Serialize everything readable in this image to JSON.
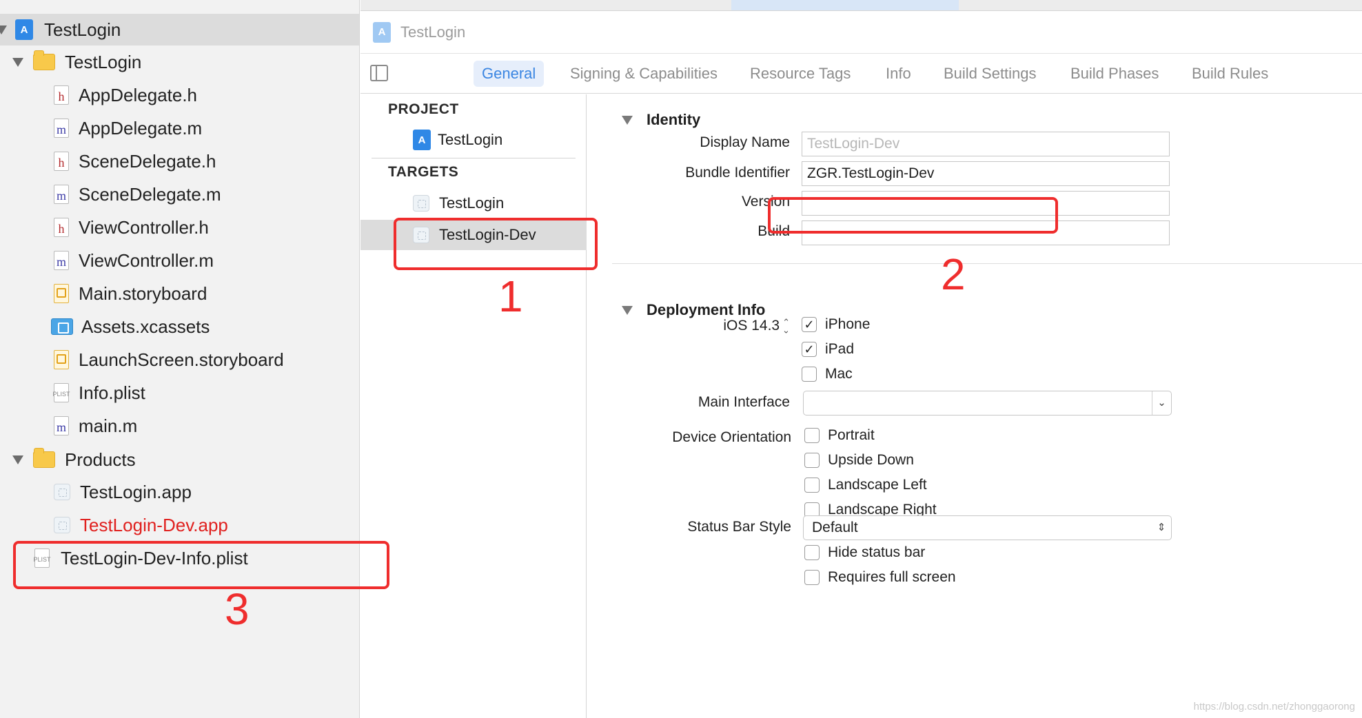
{
  "navigator": {
    "root": {
      "label": "TestLogin"
    },
    "group_testlogin": {
      "label": "TestLogin"
    },
    "files": [
      {
        "label": "AppDelegate.h",
        "kind": "h"
      },
      {
        "label": "AppDelegate.m",
        "kind": "m"
      },
      {
        "label": "SceneDelegate.h",
        "kind": "h"
      },
      {
        "label": "SceneDelegate.m",
        "kind": "m"
      },
      {
        "label": "ViewController.h",
        "kind": "h"
      },
      {
        "label": "ViewController.m",
        "kind": "m"
      },
      {
        "label": "Main.storyboard",
        "kind": "storyboard"
      },
      {
        "label": "Assets.xcassets",
        "kind": "assets"
      },
      {
        "label": "LaunchScreen.storyboard",
        "kind": "storyboard"
      },
      {
        "label": "Info.plist",
        "kind": "plist"
      },
      {
        "label": "main.m",
        "kind": "m"
      }
    ],
    "group_products": {
      "label": "Products"
    },
    "products": [
      {
        "label": "TestLogin.app",
        "color": "#222222"
      },
      {
        "label": "TestLogin-Dev.app",
        "color": "#e0201e"
      }
    ],
    "extra_file": {
      "label": "TestLogin-Dev-Info.plist"
    },
    "icon_glyphs": {
      "h": "h",
      "m": "m",
      "plist": "PLIST"
    }
  },
  "jump_bar": {
    "project": "TestLogin"
  },
  "tabs": [
    {
      "label": "General",
      "active": true
    },
    {
      "label": "Signing & Capabilities",
      "active": false
    },
    {
      "label": "Resource Tags",
      "active": false
    },
    {
      "label": "Info",
      "active": false
    },
    {
      "label": "Build Settings",
      "active": false
    },
    {
      "label": "Build Phases",
      "active": false
    },
    {
      "label": "Build Rules",
      "active": false
    }
  ],
  "targets_pane": {
    "project_header": "PROJECT",
    "project_item": "TestLogin",
    "targets_header": "TARGETS",
    "targets": [
      {
        "label": "TestLogin",
        "selected": false
      },
      {
        "label": "TestLogin-Dev",
        "selected": true
      }
    ]
  },
  "identity": {
    "header": "Identity",
    "display_name_label": "Display Name",
    "display_name_placeholder": "TestLogin-Dev",
    "bundle_id_label": "Bundle Identifier",
    "bundle_id_value": "ZGR.TestLogin-Dev",
    "version_label": "Version",
    "version_value": "",
    "build_label": "Build",
    "build_value": ""
  },
  "deployment": {
    "header": "Deployment Info",
    "ios_version": "iOS 14.3",
    "devices": [
      {
        "label": "iPhone",
        "checked": true
      },
      {
        "label": "iPad",
        "checked": true
      },
      {
        "label": "Mac",
        "checked": false
      }
    ],
    "main_interface_label": "Main Interface",
    "main_interface_value": "",
    "orientation_label": "Device Orientation",
    "orientations": [
      {
        "label": "Portrait",
        "checked": false
      },
      {
        "label": "Upside Down",
        "checked": false
      },
      {
        "label": "Landscape Left",
        "checked": false
      },
      {
        "label": "Landscape Right",
        "checked": false
      }
    ],
    "status_bar_label": "Status Bar Style",
    "status_bar_value": "Default",
    "status_options": [
      {
        "label": "Hide status bar",
        "checked": false
      },
      {
        "label": "Requires full screen",
        "checked": false
      }
    ]
  },
  "annotations": {
    "one": "1",
    "two": "2",
    "three": "3",
    "color": "#ef2d2d"
  },
  "watermark": "https://blog.csdn.net/zhonggaorong"
}
